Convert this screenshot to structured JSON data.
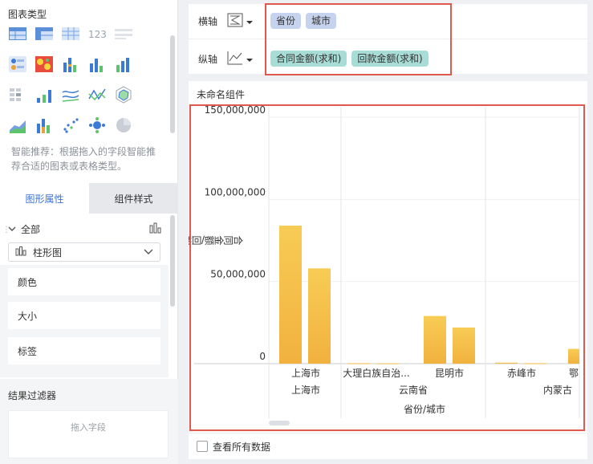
{
  "left": {
    "chart_type_title": "图表类型",
    "hint": "智能推荐：根据拖入的字段智能推荐合适的图表或表格类型。",
    "tabs": [
      "图形属性",
      "组件样式"
    ],
    "all_label": "全部",
    "chart_select": "柱形图",
    "props": [
      "颜色",
      "大小",
      "标签"
    ],
    "filter_title": "结果过滤器",
    "filter_placeholder": "拖入字段",
    "icon_names": [
      "table-icon",
      "crosstable-icon",
      "detail-table-icon",
      "kpi-number-icon",
      "text-icon",
      "blank-icon",
      "point-map-icon",
      "heat-map-icon",
      "multi-bar-icon",
      "column-icon",
      "grouped-column-icon",
      "blank2-icon",
      "heat-grid-icon",
      "step-line-icon",
      "line-icon",
      "radar-line-icon",
      "radar-icon",
      "blank3-icon",
      "area-icon",
      "stacked-column-icon",
      "scatter-icon",
      "bubble-icon",
      "pie-icon",
      "blank4-icon"
    ]
  },
  "axis": {
    "x_label": "横轴",
    "y_label": "纵轴",
    "x_fields": [
      "省份",
      "城市"
    ],
    "y_fields": [
      "合同金额(求和)",
      "回款金额(求和)"
    ]
  },
  "card": {
    "title": "未命名组件",
    "show_all": "查看所有数据"
  },
  "chart_data": {
    "type": "bar",
    "ylabel": "合同金额/回款金额",
    "xlabel": "省份/城市",
    "ylim": [
      0,
      150000000
    ],
    "y_ticks": [
      "0",
      "50,000,000",
      "100,000,000",
      "150,000,000"
    ],
    "groups": [
      {
        "province": "上海市",
        "cities": [
          "上海市"
        ]
      },
      {
        "province": "云南省",
        "cities": [
          "大理白族自治...",
          "昆明市"
        ]
      },
      {
        "province": "内蒙古",
        "cities": [
          "赤峰市",
          "鄂"
        ]
      }
    ],
    "categories": [
      "上海市",
      "大理白族自治...",
      "昆明市",
      "赤峰市",
      "鄂"
    ],
    "series": [
      {
        "name": "合同金额(求和)",
        "values": [
          84000000,
          300000,
          29000000,
          600000,
          9000000
        ]
      },
      {
        "name": "回款金额(求和)",
        "values": [
          58000000,
          200000,
          22000000,
          300000,
          0
        ]
      }
    ],
    "bar_color": "#f5c04a"
  }
}
